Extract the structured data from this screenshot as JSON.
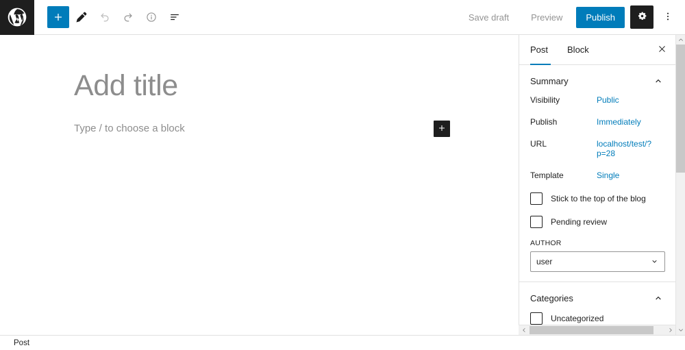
{
  "toolbar": {
    "logo_name": "wordpress-logo",
    "add_block_label": "+",
    "tools": [
      {
        "name": "add-block-icon",
        "title": "Add block"
      },
      {
        "name": "edit-tools-icon",
        "title": "Tools"
      },
      {
        "name": "undo-icon",
        "title": "Undo"
      },
      {
        "name": "redo-icon",
        "title": "Redo"
      },
      {
        "name": "details-info-icon",
        "title": "Details"
      },
      {
        "name": "list-view-icon",
        "title": "List View"
      }
    ],
    "save_draft_label": "Save draft",
    "preview_label": "Preview",
    "publish_label": "Publish",
    "settings_title": "Settings",
    "options_title": "Options",
    "accent_color": "#007cba",
    "dark_color": "#1e1e1e"
  },
  "editor": {
    "title_placeholder": "Add title",
    "block_placeholder": "Type / to choose a block",
    "inserter_label": "+"
  },
  "sidebar": {
    "tabs": [
      {
        "label": "Post",
        "active": true
      },
      {
        "label": "Block",
        "active": false
      }
    ],
    "close_label": "Close settings",
    "summary": {
      "title": "Summary",
      "rows": [
        {
          "label": "Visibility",
          "value": "Public"
        },
        {
          "label": "Publish",
          "value": "Immediately"
        },
        {
          "label": "URL",
          "value": "localhost/test/?p=28"
        },
        {
          "label": "Template",
          "value": "Single"
        }
      ],
      "checkboxes": [
        {
          "label": "Stick to the top of the blog",
          "checked": false
        },
        {
          "label": "Pending review",
          "checked": false
        }
      ],
      "author_field_label": "AUTHOR",
      "author_value": "user"
    },
    "categories": {
      "title": "Categories",
      "items": [
        {
          "label": "Uncategorized",
          "checked": false
        }
      ]
    }
  },
  "statusbar": {
    "breadcrumb": "Post"
  }
}
